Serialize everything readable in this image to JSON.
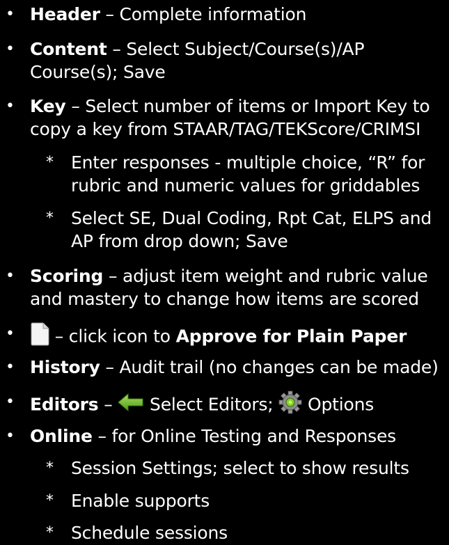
{
  "items": [
    {
      "bold": "Header",
      "text": " – Complete information"
    },
    {
      "bold": "Content",
      "line1": " – Select Subject/Course(s)/AP",
      "line2": "Course(s); Save"
    },
    {
      "bold": "Key",
      "line1": " – Select number of items or Import Key to",
      "line2": "copy a key from STAAR/TAG/TEKScore/CRIMSI"
    },
    {
      "sub": true,
      "line1": "Enter responses - multiple choice, “R” for",
      "line2": "rubric and numeric values for griddables"
    },
    {
      "sub": true,
      "line1": "Select SE, Dual Coding, Rpt Cat, ELPS and",
      "line2": "AP from drop down; Save"
    },
    {
      "bold": "Scoring",
      "line1": " – adjust item weight and rubric value",
      "line2": "and mastery to change how items are scored"
    },
    {
      "text": " – click icon to ",
      "bold": "Approve for Plain Paper",
      "icon": "document-icon"
    },
    {
      "bold": "History",
      "text": " – Audit trail (no changes can be made)"
    },
    {
      "bold": "Editors",
      "text1": " – ",
      "text2": " Select Editors; ",
      "text3": " Options",
      "icons": [
        "green-arrow-icon",
        "gear-icon"
      ]
    },
    {
      "bold": "Online",
      "text": " – for Online Testing and Responses"
    },
    {
      "sub": true,
      "text": "Session Settings; select to show results"
    },
    {
      "sub": true,
      "text": "Enable supports"
    },
    {
      "sub": true,
      "text": "Schedule sessions"
    }
  ],
  "markers": {
    "bullet": "•",
    "sub": "*"
  }
}
